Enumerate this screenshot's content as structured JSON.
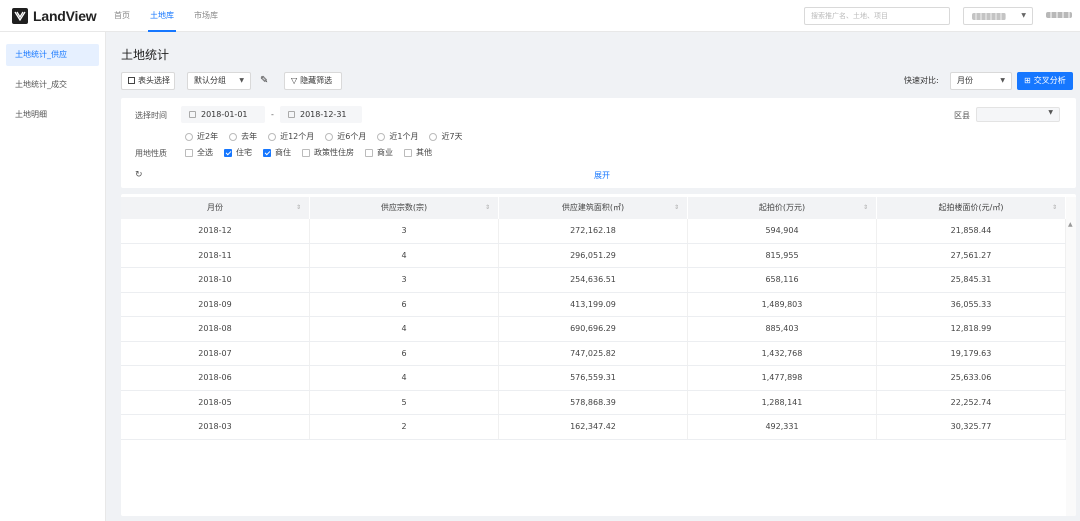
{
  "app": {
    "brand": "LandView"
  },
  "topnav": [
    {
      "label": "首页",
      "active": false
    },
    {
      "label": "土地库",
      "active": true
    },
    {
      "label": "市场库",
      "active": false
    }
  ],
  "search": {
    "placeholder": "搜索推广名、土地、项目"
  },
  "sidebar": {
    "items": [
      {
        "label": "土地统计_供应",
        "active": true
      },
      {
        "label": "土地统计_成交",
        "active": false
      },
      {
        "label": "土地明细",
        "active": false
      }
    ]
  },
  "page": {
    "title": "土地统计"
  },
  "toolbar": {
    "column_select": "表头选择",
    "group_value": "默认分组",
    "hide_filter": "隐藏筛选",
    "quick_compare_label": "快速对比:",
    "quick_compare_value": "月份",
    "cross_analysis": "交叉分析"
  },
  "filter": {
    "time_label": "选择时间",
    "start_date": "2018-01-01",
    "end_date": "2018-12-31",
    "date_sep": "-",
    "ranges": [
      "近2年",
      "去年",
      "近12个月",
      "近6个月",
      "近1个月",
      "近7天"
    ],
    "usage_label": "用地性质",
    "usages": [
      {
        "label": "全选",
        "checked": false
      },
      {
        "label": "住宅",
        "checked": true
      },
      {
        "label": "商住",
        "checked": true
      },
      {
        "label": "政策性住房",
        "checked": false
      },
      {
        "label": "商业",
        "checked": false
      },
      {
        "label": "其他",
        "checked": false
      }
    ],
    "region_label": "区县",
    "expand": "展开"
  },
  "table": {
    "headers": [
      "月份",
      "供应宗数(宗)",
      "供应建筑面积(㎡)",
      "起拍价(万元)",
      "起拍楼面价(元/㎡)"
    ],
    "rows": [
      [
        "2018-12",
        "3",
        "272,162.18",
        "594,904",
        "21,858.44"
      ],
      [
        "2018-11",
        "4",
        "296,051.29",
        "815,955",
        "27,561.27"
      ],
      [
        "2018-10",
        "3",
        "254,636.51",
        "658,116",
        "25,845.31"
      ],
      [
        "2018-09",
        "6",
        "413,199.09",
        "1,489,803",
        "36,055.33"
      ],
      [
        "2018-08",
        "4",
        "690,696.29",
        "885,403",
        "12,818.99"
      ],
      [
        "2018-07",
        "6",
        "747,025.82",
        "1,432,768",
        "19,179.63"
      ],
      [
        "2018-06",
        "4",
        "576,559.31",
        "1,477,898",
        "25,633.06"
      ],
      [
        "2018-05",
        "5",
        "578,868.39",
        "1,288,141",
        "22,252.74"
      ],
      [
        "2018-03",
        "2",
        "162,347.42",
        "492,331",
        "30,325.77"
      ]
    ]
  },
  "icons": {
    "sort": "sort-icon",
    "calendar": "calendar-icon",
    "reset": "reset-icon",
    "edit": "edit-icon",
    "filter": "filter-icon",
    "grid": "grid-icon"
  },
  "colors": {
    "accent": "#1677ff",
    "background": "#f0f2f5"
  }
}
